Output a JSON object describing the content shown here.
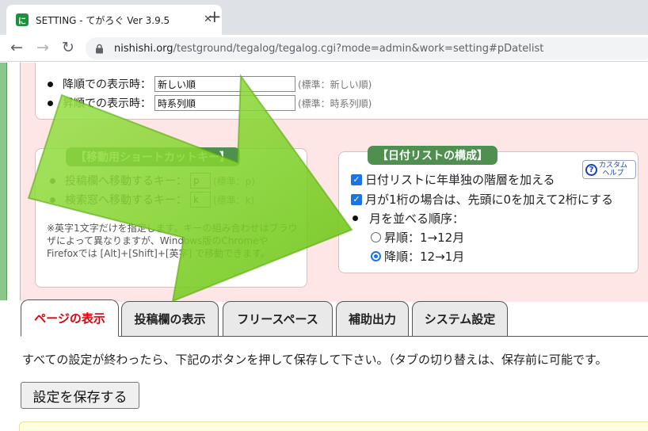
{
  "browser": {
    "tab_title": "SETTING - てがろぐ Ver 3.9.5",
    "favicon_label": "に",
    "url_host": "nishishi.org",
    "url_path": "/testground/tegalog/tegalog.cgi?mode=admin&work=setting#pDatelist",
    "icons": [
      "back-icon",
      "forward-icon",
      "reload-icon",
      "lock-icon",
      "close-icon",
      "plus-icon"
    ]
  },
  "sort_display": {
    "desc_label": "降順での表示時：",
    "desc_value": "新しい順",
    "desc_hint": "(標準：新しい順)",
    "asc_label": "昇順での表示時：",
    "asc_value": "時系列順",
    "asc_hint": "(標準：時系列順)"
  },
  "shortcut": {
    "title": "【移動用ショートカットキー】",
    "post_label": "投稿欄へ移動するキー：",
    "post_value": "p",
    "post_hint": "(標準：p)",
    "search_label": "検索窓へ移動するキー：",
    "search_value": "k",
    "search_hint": "(標準：k)",
    "note": "※英字1文字だけを指定します。キーの組み合わせはブラウザによって異なりますが、Windows版のChromeやFirefoxでは [Alt]+[Shift]+[英字] で移動できます。"
  },
  "date_list": {
    "title": "【日付リストの構成】",
    "help_line1": "カスタム",
    "help_line2": "ヘルプ",
    "option_year": "日付リストに年単独の階層を加える",
    "option_zero": "月が1桁の場合は、先頭に0を加えて2桁にする",
    "order_label": "月を並べる順序：",
    "order_asc": "昇順：1→12月",
    "order_desc": "降順：12→1月",
    "selected_order": "降順：12→1月"
  },
  "tabs": [
    "ページの表示",
    "投稿欄の表示",
    "フリースペース",
    "補助出力",
    "システム設定"
  ],
  "active_tab": "ページの表示",
  "save_message": "すべての設定が終わったら、下記のボタンを押して保存して下さい。（タブの切り替えは、保存前に可能です。",
  "save_button": "設定を保存する",
  "colors": {
    "arrow_fill": "#7ed321",
    "section_title_bg": "#4f8f4f",
    "active_tab_text": "#e0000b",
    "pink_panel": "#ffe6e6"
  }
}
